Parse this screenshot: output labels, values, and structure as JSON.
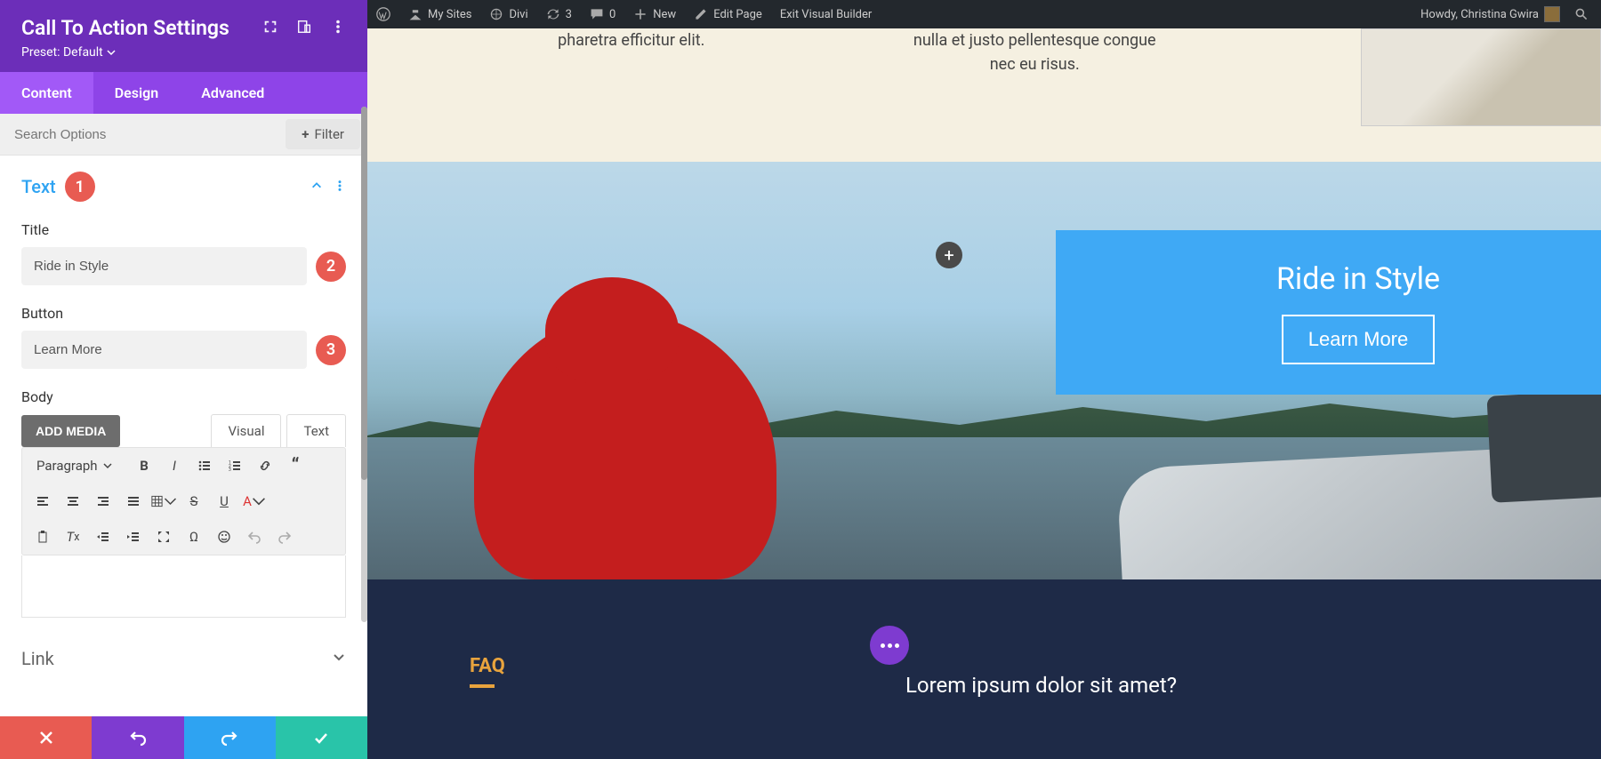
{
  "admin_bar": {
    "my_sites": "My Sites",
    "site_name": "Divi",
    "refresh_count": "3",
    "comment_count": "0",
    "new": "New",
    "edit_page": "Edit Page",
    "exit_builder": "Exit Visual Builder",
    "howdy": "Howdy, Christina Gwira"
  },
  "sidebar": {
    "title": "Call To Action Settings",
    "preset_label": "Preset: Default",
    "tabs": {
      "content": "Content",
      "design": "Design",
      "advanced": "Advanced"
    },
    "search_placeholder": "Search Options",
    "filter_label": "Filter",
    "section_text": "Text",
    "badge1": "1",
    "title_label": "Title",
    "title_value": "Ride in Style",
    "badge2": "2",
    "button_label": "Button",
    "button_value": "Learn More",
    "badge3": "3",
    "body_label": "Body",
    "add_media": "ADD MEDIA",
    "editor_tab_visual": "Visual",
    "editor_tab_text": "Text",
    "paragraph": "Paragraph",
    "link_section": "Link"
  },
  "preview": {
    "col1": "pharetra efficitur elit.",
    "col2a": "nulla et justo pellentesque congue",
    "col2b": "nec eu risus.",
    "cta_title": "Ride in Style",
    "cta_button": "Learn More",
    "faq": "FAQ",
    "faq_q": "Lorem ipsum dolor sit amet?"
  }
}
